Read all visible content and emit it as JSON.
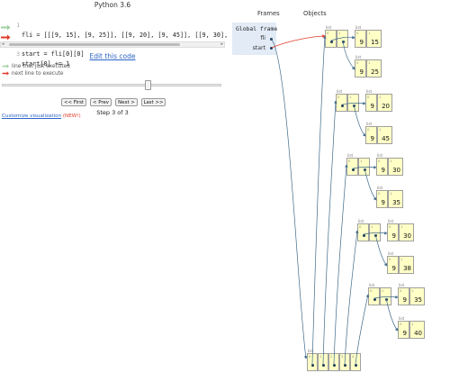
{
  "header": {
    "title": "Python 3.6"
  },
  "code": {
    "lines": [
      {
        "num": "1",
        "text": "fli = [[[9, 15], [9, 25]], [[9, 20], [9, 45]], [[9, 30], ["
      },
      {
        "num": "2",
        "text": "start = fli[0][0]"
      },
      {
        "num": "3",
        "text": "start[0] += 1"
      }
    ]
  },
  "links": {
    "edit": "Edit this code",
    "customize": "Customize visualization",
    "new": "(NEW!)"
  },
  "legend": {
    "executed": "line that just executed",
    "next": "next line to execute"
  },
  "nav": {
    "first": "<< First",
    "prev": "< Prev",
    "next": "Next >",
    "last": "Last >>"
  },
  "step": "Step 3 of 3",
  "viz": {
    "frames_header": "Frames",
    "objects_header": "Objects",
    "global_frame": "Global frame",
    "vars": [
      "fli",
      "start"
    ],
    "list_label": "list",
    "idx0": "0",
    "idx1": "1",
    "idx2": "2",
    "idx3": "3",
    "idx4": "4",
    "pairs": [
      {
        "a": "9",
        "b": "15"
      },
      {
        "a": "9",
        "b": "25"
      },
      {
        "a": "9",
        "b": "20"
      },
      {
        "a": "9",
        "b": "45"
      },
      {
        "a": "9",
        "b": "30"
      },
      {
        "a": "9",
        "b": "35"
      },
      {
        "a": "9",
        "b": "30"
      },
      {
        "a": "9",
        "b": "38"
      },
      {
        "a": "9",
        "b": "35"
      },
      {
        "a": "9",
        "b": "40"
      }
    ]
  },
  "colors": {
    "link": "#2b64c4",
    "frame_bg": "#e2ebf6",
    "heap_bg": "#ffffc6",
    "arrow": "#3e6a8a",
    "red_arrow": "#e03b2b",
    "green_arrow": "#a0d0a0"
  }
}
